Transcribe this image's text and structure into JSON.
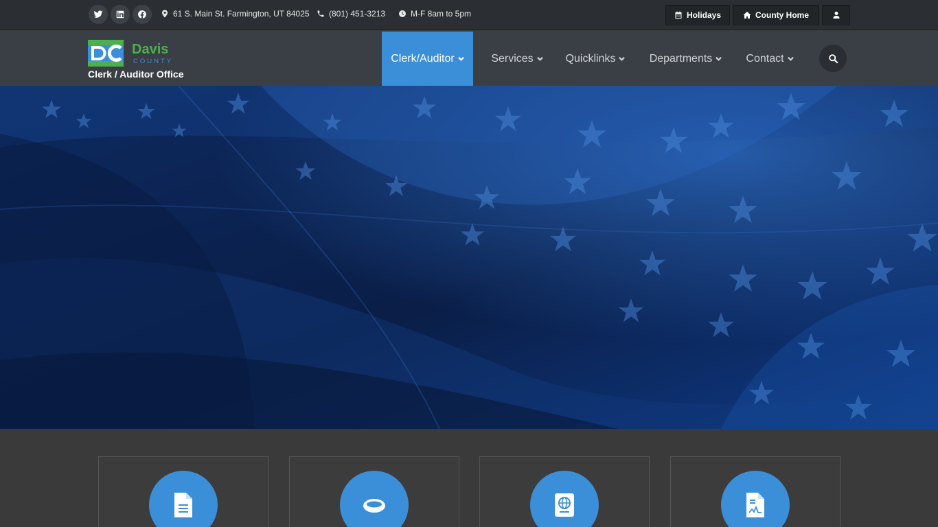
{
  "topbar": {
    "address": "61 S. Main St. Farmington, UT 84025",
    "phone": "(801) 451-3213",
    "hours": "M-F 8am to 5pm",
    "holidays_label": "Holidays",
    "county_home_label": "County Home"
  },
  "header": {
    "logo_name": "Davis",
    "logo_county": "COUNTY",
    "subtitle": "Clerk / Auditor Office",
    "nav": [
      {
        "label": "Clerk/Auditor"
      },
      {
        "label": "Services"
      },
      {
        "label": "Quicklinks"
      },
      {
        "label": "Departments"
      },
      {
        "label": "Contact"
      }
    ]
  },
  "colors": {
    "accent": "#3a8fd8",
    "logo_green": "#4caf50",
    "topbar": "#2b2f33",
    "header": "#3a3f45"
  },
  "icons": {
    "social": [
      "twitter-icon",
      "linkedin-icon",
      "facebook-icon"
    ],
    "cards": [
      "document-icon",
      "ring-icon",
      "passport-icon",
      "certificate-icon"
    ]
  }
}
